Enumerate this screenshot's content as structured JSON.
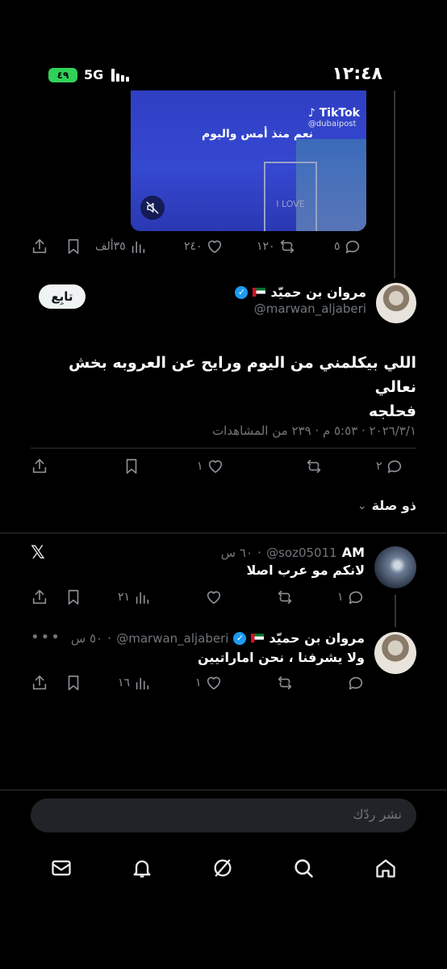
{
  "status_bar": {
    "time": "١٢:٤٨",
    "battery": "٤٩",
    "network": "5G"
  },
  "video": {
    "caption": "نعم منذ أمس واليوم",
    "watermark_brand": "TikTok",
    "watermark_handle": "@dubaipost"
  },
  "quoted_stats": {
    "replies": "٥",
    "reposts": "١٢٠",
    "likes": "٢٤٠",
    "views": "٣٥ألف"
  },
  "main_tweet": {
    "author_name": "مروان بن حميّد",
    "handle": "@marwan_aljaberi",
    "follow_label": "تابِع",
    "text_line1": "اللي بيكلمني من اليوم ورايح عن العروبه بخش نعالي",
    "text_line2": "فحلجه",
    "meta": "٢٠٢٦/٣/١ · ٥:٥٣ م · ٢٣٩ من المشاهدات",
    "replies": "٢",
    "likes": "١"
  },
  "related_label": "ذو صلة",
  "reply1": {
    "handle": "@soz05011",
    "name_suffix": "AM",
    "time": "٦٠ س",
    "text": "لانكم مو عرب اصلا",
    "replies": "١",
    "views": "٢١"
  },
  "reply2": {
    "author_name": "مروان بن حميّد",
    "handle": "@marwan_aljaberi",
    "time": "٥٠ س",
    "text": "ولا يشرفنا ، نحن اماراتيين",
    "likes": "١",
    "views": "١٦"
  },
  "compose": {
    "placeholder": "نشر ردّك"
  },
  "colors": {
    "verified": "#1d9bf0",
    "background": "#000000",
    "muted": "#71767b"
  }
}
